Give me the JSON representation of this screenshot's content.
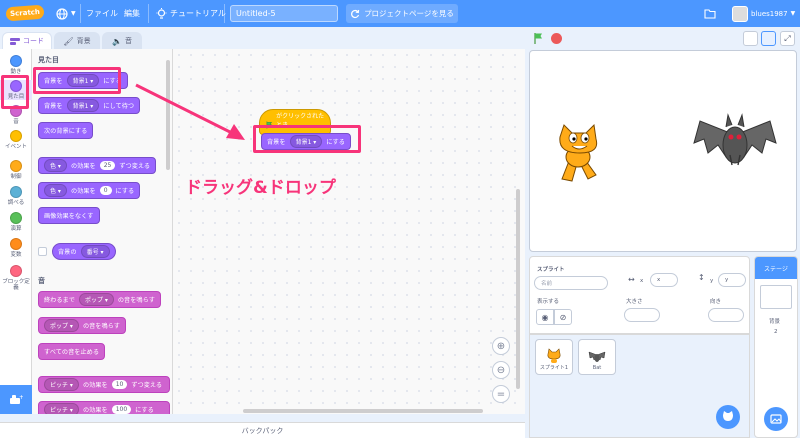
{
  "menubar": {
    "logo": "Scratch",
    "file": "ファイル",
    "edit": "編集",
    "tutorial": "チュートリアル",
    "project_title": "Untitled-5",
    "project_page": "プロジェクトページを見る",
    "username": "blues1987"
  },
  "tabs": {
    "code": "コード",
    "costumes": "背景",
    "sounds": "音"
  },
  "categories": [
    {
      "label": "動き",
      "color": "#4c97ff"
    },
    {
      "label": "見た目",
      "color": "#9966ff"
    },
    {
      "label": "音",
      "color": "#cf63cf"
    },
    {
      "label": "イベント",
      "color": "#ffbf00"
    },
    {
      "label": "制御",
      "color": "#ffab19"
    },
    {
      "label": "調べる",
      "color": "#5cb1d6"
    },
    {
      "label": "演算",
      "color": "#59c059"
    },
    {
      "label": "変数",
      "color": "#ff8c1a"
    },
    {
      "label": "ブロック定義",
      "color": "#ff6680"
    }
  ],
  "palette": {
    "looks_heading": "見た目",
    "sound_heading": "音",
    "b1": {
      "pre": "背景を",
      "dd": "背景1",
      "post": "にする"
    },
    "b2": {
      "pre": "背景を",
      "dd": "背景1",
      "post": "にして待つ"
    },
    "b3": "次の背景にする",
    "b4": {
      "dd": "色",
      "mid": "の効果を",
      "num": "25",
      "post": "ずつ変える"
    },
    "b5": {
      "dd": "色",
      "mid": "の効果を",
      "num": "0",
      "post": "にする"
    },
    "b6": "画像効果をなくす",
    "b7": {
      "pre": "背景の",
      "dd": "番号"
    },
    "s1": {
      "pre": "終わるまで",
      "dd": "ポップ",
      "post": "の音を鳴らす"
    },
    "s2": {
      "dd": "ポップ",
      "post": "の音を鳴らす"
    },
    "s3": "すべての音を止める",
    "s4": {
      "dd": "ピッチ",
      "mid": "の効果を",
      "num": "10",
      "post": "ずつ変える"
    },
    "s5": {
      "dd": "ピッチ",
      "mid": "の効果を",
      "num": "100",
      "post": "にする"
    }
  },
  "workspace": {
    "hat": "がクリックされたとき",
    "block": {
      "pre": "背景を",
      "dd": "背景1",
      "post": "にする"
    },
    "annotation": "ドラッグ&ドロップ"
  },
  "backpack": "バックパック",
  "sprite_info": {
    "sprite_label": "スプライト",
    "name_placeholder": "名前",
    "x_label": "x",
    "x_value": "x",
    "y_label": "y",
    "y_value": "y",
    "show_label": "表示する",
    "size_label": "大きさ",
    "direction_label": "向き"
  },
  "sprites": [
    {
      "name": "スプライト1"
    },
    {
      "name": "Bat"
    }
  ],
  "stage_panel": {
    "title": "ステージ",
    "backdrops_label": "背景",
    "backdrops_count": "2"
  },
  "colors": {
    "accent": "#4c97ff",
    "looks": "#9966ff",
    "sound": "#cf63cf",
    "annotation": "#f7347a"
  }
}
